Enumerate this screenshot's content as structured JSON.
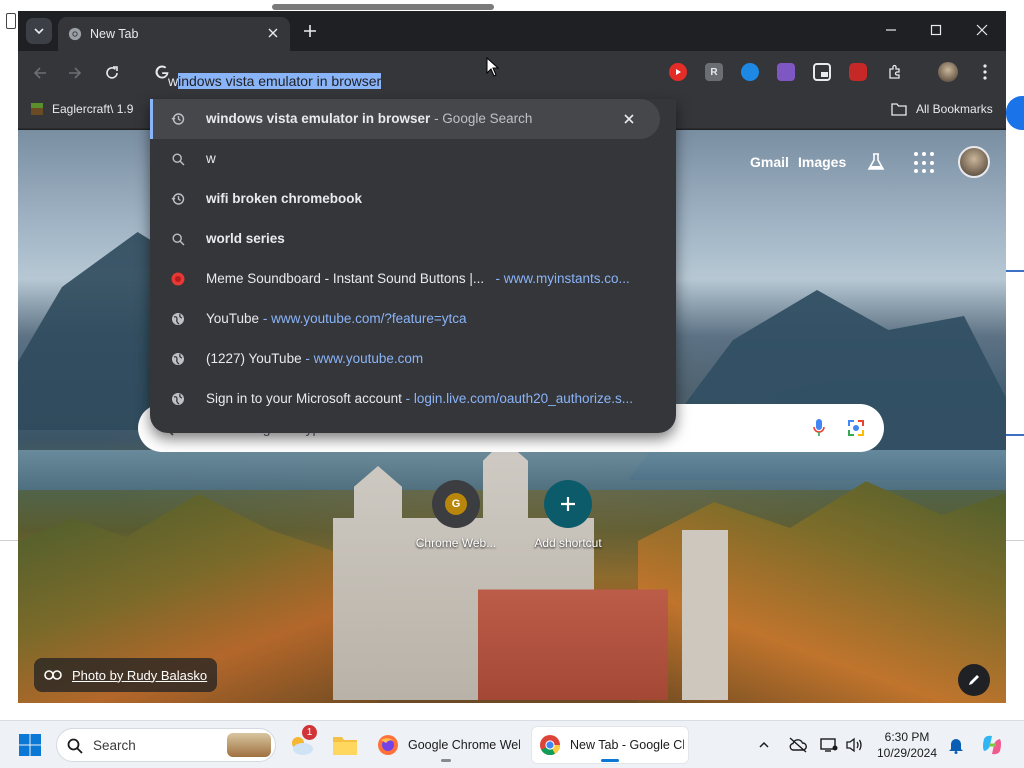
{
  "browser": {
    "tab": {
      "title": "New Tab"
    },
    "omnibox": {
      "typed": "w",
      "autocomplete": "indows vista emulator in browser"
    },
    "bookmarks_bar": {
      "items": [
        {
          "label": "Eaglercraft\\ 1.9"
        }
      ],
      "all_bookmarks_label": "All Bookmarks"
    },
    "extensions": [
      {
        "name": "youtube-ext",
        "color": "#e52d27"
      },
      {
        "name": "r-ext",
        "label": "R",
        "color": "#9aa0a6"
      },
      {
        "name": "blue-ext",
        "color": "#1e88e5"
      },
      {
        "name": "purple-ext",
        "color": "#7e57c2"
      },
      {
        "name": "pip-ext",
        "color": "#e8eaed"
      },
      {
        "name": "ublock-ext",
        "color": "#c62828"
      }
    ]
  },
  "suggestions": [
    {
      "icon": "history-icon",
      "bold": "windows vista emulator in browser",
      "suffix": " - Google Search",
      "url": ""
    },
    {
      "icon": "search-icon",
      "bold": "w",
      "suffix": "",
      "url": ""
    },
    {
      "icon": "history-icon",
      "bold": "wifi broken chromebook",
      "suffix": "",
      "url": ""
    },
    {
      "icon": "search-icon",
      "bold": "world series",
      "suffix": "",
      "url": ""
    },
    {
      "icon": "myinstants-icon",
      "plain": "Meme Soundboard - Instant Sound Buttons |...",
      "suffix": "",
      "url": "- www.myinstants.co..."
    },
    {
      "icon": "globe-icon",
      "plain": "YouTube",
      "suffix": "",
      "url": "- www.youtube.com/?feature=ytca"
    },
    {
      "icon": "globe-icon",
      "plain": "(1227) YouTube",
      "suffix": "",
      "url": "- www.youtube.com"
    },
    {
      "icon": "globe-icon",
      "plain": "Sign in to your Microsoft account",
      "suffix": "",
      "url": "- login.live.com/oauth20_authorize.s..."
    }
  ],
  "ntp": {
    "gmail_label": "Gmail",
    "images_label": "Images",
    "search_placeholder": "Search Google or type a URL",
    "shortcuts": [
      {
        "label": "Chrome Web...",
        "letter": "G"
      },
      {
        "label": "Add shortcut",
        "letter": "+"
      }
    ],
    "photo_credit": "Photo by Rudy Balasko"
  },
  "taskbar": {
    "search_label": "Search",
    "weather_badge": "1",
    "apps": [
      {
        "label": "Google Chrome Web"
      },
      {
        "label": "New Tab - Google Ch"
      }
    ],
    "time": "6:30 PM",
    "date": "10/29/2024"
  }
}
